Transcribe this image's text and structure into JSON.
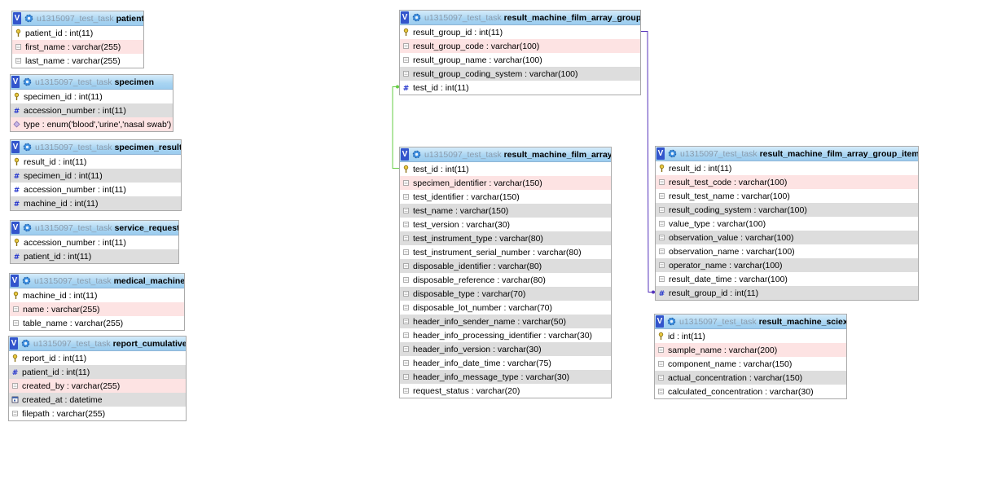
{
  "tables": [
    {
      "id": "patient",
      "db": "u1315097_test_task",
      "name": "patient",
      "columns": [
        {
          "text": "patient_id : int(11)",
          "icon": "primary-key-icon",
          "bg": "white"
        },
        {
          "text": "first_name : varchar(255)",
          "icon": "column-icon",
          "bg": "pink"
        },
        {
          "text": "last_name : varchar(255)",
          "icon": "column-icon",
          "bg": "white"
        }
      ]
    },
    {
      "id": "specimen",
      "db": "u1315097_test_task",
      "name": "specimen",
      "columns": [
        {
          "text": "specimen_id : int(11)",
          "icon": "primary-key-icon",
          "bg": "white"
        },
        {
          "text": "accession_number : int(11)",
          "icon": "index-icon",
          "bg": "gray"
        },
        {
          "text": "type : enum('blood','urine','nasal swab')",
          "icon": "enum-icon",
          "bg": "pink"
        }
      ]
    },
    {
      "id": "specimen_result",
      "db": "u1315097_test_task",
      "name": "specimen_result",
      "columns": [
        {
          "text": "result_id : int(11)",
          "icon": "primary-key-icon",
          "bg": "white"
        },
        {
          "text": "specimen_id : int(11)",
          "icon": "index-icon",
          "bg": "gray"
        },
        {
          "text": "accession_number : int(11)",
          "icon": "index-icon",
          "bg": "white"
        },
        {
          "text": "machine_id : int(11)",
          "icon": "index-icon",
          "bg": "gray"
        }
      ]
    },
    {
      "id": "service_request",
      "db": "u1315097_test_task",
      "name": "service_request",
      "columns": [
        {
          "text": "accession_number : int(11)",
          "icon": "primary-key-icon",
          "bg": "white"
        },
        {
          "text": "patient_id : int(11)",
          "icon": "index-icon",
          "bg": "gray"
        }
      ]
    },
    {
      "id": "medical_machine",
      "db": "u1315097_test_task",
      "name": "medical_machine",
      "columns": [
        {
          "text": "machine_id : int(11)",
          "icon": "primary-key-icon",
          "bg": "white"
        },
        {
          "text": "name : varchar(255)",
          "icon": "column-icon",
          "bg": "pink"
        },
        {
          "text": "table_name : varchar(255)",
          "icon": "column-icon",
          "bg": "white"
        }
      ]
    },
    {
      "id": "report_cumulative",
      "db": "u1315097_test_task",
      "name": "report_cumulative",
      "columns": [
        {
          "text": "report_id : int(11)",
          "icon": "primary-key-icon",
          "bg": "white"
        },
        {
          "text": "patient_id : int(11)",
          "icon": "index-icon",
          "bg": "gray"
        },
        {
          "text": "created_by : varchar(255)",
          "icon": "column-icon",
          "bg": "pink"
        },
        {
          "text": "created_at : datetime",
          "icon": "datetime-icon",
          "bg": "gray"
        },
        {
          "text": "filepath : varchar(255)",
          "icon": "column-icon",
          "bg": "white"
        }
      ]
    },
    {
      "id": "result_machine_film_array_group",
      "db": "u1315097_test_task",
      "name": "result_machine_film_array_group",
      "columns": [
        {
          "text": "result_group_id : int(11)",
          "icon": "primary-key-icon",
          "bg": "white"
        },
        {
          "text": "result_group_code : varchar(100)",
          "icon": "column-icon",
          "bg": "pink"
        },
        {
          "text": "result_group_name : varchar(100)",
          "icon": "column-icon",
          "bg": "white"
        },
        {
          "text": "result_group_coding_system : varchar(100)",
          "icon": "column-icon",
          "bg": "gray"
        },
        {
          "text": "test_id : int(11)",
          "icon": "index-icon",
          "bg": "white"
        }
      ]
    },
    {
      "id": "result_machine_film_array",
      "db": "u1315097_test_task",
      "name": "result_machine_film_array",
      "columns": [
        {
          "text": "test_id : int(11)",
          "icon": "primary-key-icon",
          "bg": "white"
        },
        {
          "text": "specimen_identifier : varchar(150)",
          "icon": "column-icon",
          "bg": "pink"
        },
        {
          "text": "test_identifier : varchar(150)",
          "icon": "column-icon",
          "bg": "white"
        },
        {
          "text": "test_name : varchar(150)",
          "icon": "column-icon",
          "bg": "gray"
        },
        {
          "text": "test_version : varchar(30)",
          "icon": "column-icon",
          "bg": "white"
        },
        {
          "text": "test_instrument_type : varchar(80)",
          "icon": "column-icon",
          "bg": "gray"
        },
        {
          "text": "test_instrument_serial_number : varchar(80)",
          "icon": "column-icon",
          "bg": "white"
        },
        {
          "text": "disposable_identifier : varchar(80)",
          "icon": "column-icon",
          "bg": "gray"
        },
        {
          "text": "disposable_reference : varchar(80)",
          "icon": "column-icon",
          "bg": "white"
        },
        {
          "text": "disposable_type : varchar(70)",
          "icon": "column-icon",
          "bg": "gray"
        },
        {
          "text": "disposable_lot_number : varchar(70)",
          "icon": "column-icon",
          "bg": "white"
        },
        {
          "text": "header_info_sender_name : varchar(50)",
          "icon": "column-icon",
          "bg": "gray"
        },
        {
          "text": "header_info_processing_identifier : varchar(30)",
          "icon": "column-icon",
          "bg": "white"
        },
        {
          "text": "header_info_version : varchar(30)",
          "icon": "column-icon",
          "bg": "gray"
        },
        {
          "text": "header_info_date_time : varchar(75)",
          "icon": "column-icon",
          "bg": "white"
        },
        {
          "text": "header_info_message_type : varchar(30)",
          "icon": "column-icon",
          "bg": "gray"
        },
        {
          "text": "request_status : varchar(20)",
          "icon": "column-icon",
          "bg": "white"
        }
      ]
    },
    {
      "id": "result_machine_film_array_group_item",
      "db": "u1315097_test_task",
      "name": "result_machine_film_array_group_item",
      "columns": [
        {
          "text": "result_id : int(11)",
          "icon": "primary-key-icon",
          "bg": "white"
        },
        {
          "text": "result_test_code : varchar(100)",
          "icon": "column-icon",
          "bg": "pink"
        },
        {
          "text": "result_test_name : varchar(100)",
          "icon": "column-icon",
          "bg": "white"
        },
        {
          "text": "result_coding_system : varchar(100)",
          "icon": "column-icon",
          "bg": "gray"
        },
        {
          "text": "value_type : varchar(100)",
          "icon": "column-icon",
          "bg": "white"
        },
        {
          "text": "observation_value : varchar(100)",
          "icon": "column-icon",
          "bg": "gray"
        },
        {
          "text": "observation_name : varchar(100)",
          "icon": "column-icon",
          "bg": "white"
        },
        {
          "text": "operator_name : varchar(100)",
          "icon": "column-icon",
          "bg": "gray"
        },
        {
          "text": "result_date_time : varchar(100)",
          "icon": "column-icon",
          "bg": "white"
        },
        {
          "text": "result_group_id : int(11)",
          "icon": "index-icon",
          "bg": "gray"
        }
      ]
    },
    {
      "id": "result_machine_sciex",
      "db": "u1315097_test_task",
      "name": "result_machine_sciex",
      "columns": [
        {
          "text": "id : int(11)",
          "icon": "primary-key-icon",
          "bg": "white"
        },
        {
          "text": "sample_name : varchar(200)",
          "icon": "column-icon",
          "bg": "pink"
        },
        {
          "text": "component_name : varchar(150)",
          "icon": "column-icon",
          "bg": "white"
        },
        {
          "text": "actual_concentration : varchar(150)",
          "icon": "column-icon",
          "bg": "gray"
        },
        {
          "text": "calculated_concentration : varchar(30)",
          "icon": "column-icon",
          "bg": "white"
        }
      ]
    }
  ],
  "toggle_label": "V",
  "relations": [
    {
      "from": "result_machine_film_array_group.test_id",
      "to": "result_machine_film_array.test_id",
      "color": "#66cc44"
    },
    {
      "from": "result_machine_film_array_group_item.result_group_id",
      "to": "result_machine_film_array_group.result_group_id",
      "color": "#5533bb"
    }
  ]
}
